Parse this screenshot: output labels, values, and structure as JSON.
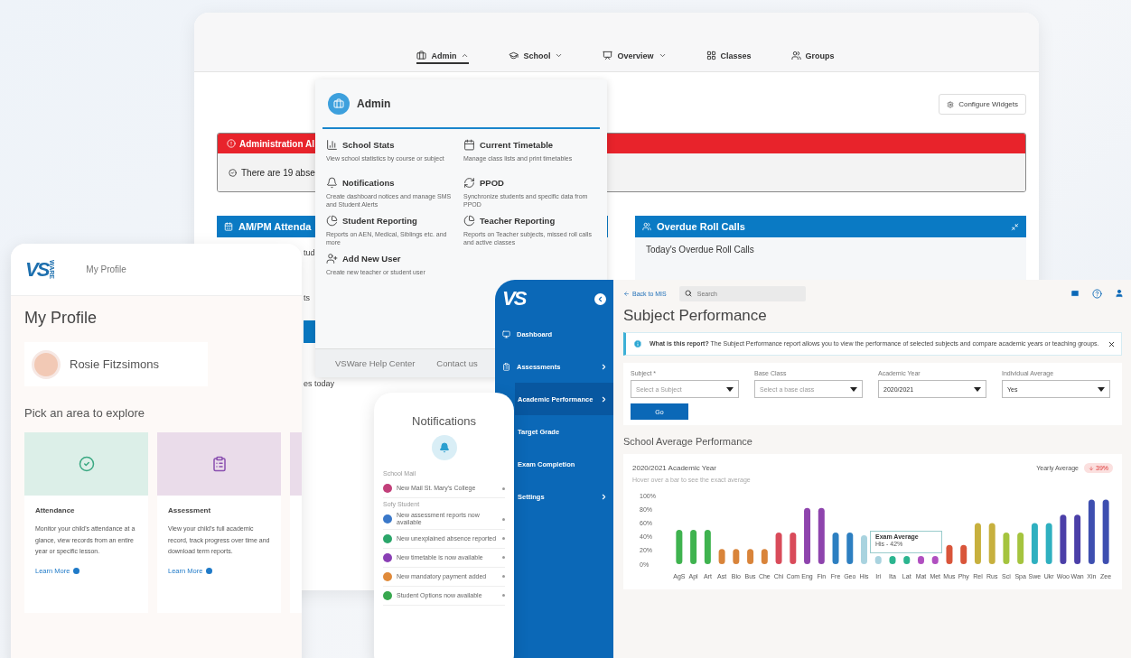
{
  "dashboard": {
    "nav": [
      {
        "label": "Admin",
        "kind": "admin",
        "selected": true,
        "expanded": true
      },
      {
        "label": "School",
        "kind": "school",
        "selected": false,
        "expanded": false
      },
      {
        "label": "Overview",
        "kind": "overview",
        "selected": false,
        "expanded": false
      },
      {
        "label": "Classes",
        "kind": "classes",
        "selected": false
      },
      {
        "label": "Groups",
        "kind": "groups",
        "selected": false
      }
    ],
    "configure_button": "Configure Widgets",
    "alert": {
      "title": "Administration Al",
      "message": "There are 19 abse"
    },
    "attendance_widget": {
      "title": "AM/PM Attenda",
      "lines": [
        "tud",
        "ts",
        "es today"
      ]
    },
    "overdue_widget": {
      "title": "Overdue Roll Calls",
      "subtitle": "Today's Overdue Roll Calls"
    }
  },
  "admin_menu": {
    "title": "Admin",
    "items": [
      {
        "kind": "stats",
        "title": "School Stats",
        "description": "View school statistics by course or subject"
      },
      {
        "kind": "timetable",
        "title": "Current Timetable",
        "description": "Manage class lists and print timetables"
      },
      {
        "kind": "notifications",
        "title": "Notifications",
        "description": "Create dashboard notices and manage SMS and Student Alerts"
      },
      {
        "kind": "sync",
        "title": "PPOD",
        "description": "Synchronize students and specific data from PPOD"
      },
      {
        "kind": "report",
        "title": "Student Reporting",
        "description": "Reports on AEN, Medical, Siblings etc. and more"
      },
      {
        "kind": "report",
        "title": "Teacher Reporting",
        "description": "Reports on Teacher subjects, missed roll calls and active classes"
      },
      {
        "kind": "user",
        "title": "Add New User",
        "description": "Create new teacher or student user"
      }
    ],
    "footer": [
      "VSWare Help Center",
      "Contact us"
    ]
  },
  "profile": {
    "logo": "VS",
    "logo_small": "WARE",
    "header": "My Profile",
    "title": "My Profile",
    "name": "Rosie Fitzsimons",
    "section": "Pick an area to explore",
    "areas": [
      {
        "kind": "attendance",
        "color": "#dcefe8",
        "title": "Attendance",
        "description": "Monitor your child's attendance at a glance, view records from an entire year or specific lesson.",
        "link": "Learn More"
      },
      {
        "kind": "assessment",
        "color": "#eadcea",
        "title": "Assessment",
        "description": "View your child's full academic record, track progress over time and download term reports.",
        "link": "Learn More"
      },
      {
        "kind": "partial",
        "color": "#eadcea"
      }
    ]
  },
  "notifications": {
    "title": "Notifications",
    "sections": [
      {
        "label": "School Mail",
        "items": [
          {
            "text": "New Mail St. Mary's College",
            "color": "#c2407a"
          }
        ]
      },
      {
        "label": "Sofy Student",
        "items": [
          {
            "text": "New assessment reports now available",
            "color": "#3a78c9"
          },
          {
            "text": "New unexplained absence reported",
            "color": "#2ba66a"
          },
          {
            "text": "New timetable is now available",
            "color": "#8a3fb5"
          },
          {
            "text": "New mandatory payment added",
            "color": "#e08a3a"
          },
          {
            "text": "Student Options now available",
            "color": "#38a84f"
          }
        ]
      }
    ]
  },
  "sidebar": {
    "logo": "VS",
    "items": [
      {
        "label": "Dashboard",
        "kind": "dashboard",
        "selected": false,
        "submenu": false
      },
      {
        "label": "Assessments",
        "kind": "assessments",
        "selected": false,
        "submenu": true
      },
      {
        "label": "Academic Performance",
        "kind": "none",
        "selected": true,
        "submenu": true
      },
      {
        "label": "Target Grade",
        "kind": "none",
        "selected": false,
        "submenu": false
      },
      {
        "label": "Exam Completion",
        "kind": "none",
        "selected": false,
        "submenu": false
      },
      {
        "label": "Settings",
        "kind": "none",
        "selected": false,
        "submenu": true
      }
    ]
  },
  "report": {
    "back_link": "Back to MIS",
    "search": {
      "placeholder": "Search"
    },
    "title": "Subject Performance",
    "info": "**What is this report?** The Subject Performance report allows you to view the performance of selected subjects and compare academic years or teaching groups.",
    "filters": [
      {
        "label": "Subject *",
        "placeholder": "Select a Subject"
      },
      {
        "label": "Base Class",
        "placeholder": "Select a base class"
      },
      {
        "label": "Academic Year",
        "value": "2020/2021"
      },
      {
        "label": "Individual Average",
        "value": "Yes"
      }
    ],
    "go_button": "Go",
    "section": "School Average Performance",
    "chart_card": {
      "title": "2020/2021 Academic Year",
      "hint": "Hover over a bar to see the exact average",
      "badge_label": "Yearly Average",
      "badge_value": "39%",
      "tooltip": {
        "text": "His - 42%"
      },
      "chart_data": {
        "type": "bar",
        "categories": [
          "AgS",
          "Apl",
          "Art",
          "Ast",
          "Bio",
          "Bus",
          "Che",
          "Chi",
          "Com",
          "Eng",
          "Fin",
          "Fre",
          "Geo",
          "His",
          "Iri",
          "Ita",
          "Lat",
          "Mat",
          "Met",
          "Mus",
          "Phy",
          "Rel",
          "Rus",
          "Sci",
          "Spa",
          "Swe",
          "Ukr",
          "Woo",
          "Wan",
          "Xin",
          "Zee"
        ],
        "series": [
          {
            "name": "Exam Average",
            "color": "#3fb34f",
            "values": [
              50,
              50,
              50,
              null,
              null,
              null,
              null,
              null,
              null,
              null,
              null,
              null,
              null,
              null,
              null,
              null,
              null,
              null,
              null,
              null,
              null,
              null,
              null,
              null,
              null,
              null,
              null,
              null,
              null,
              null,
              null
            ]
          },
          {
            "color": "#d9843a",
            "values": [
              null,
              null,
              null,
              22,
              22,
              22,
              22,
              null,
              null,
              null,
              null,
              null,
              null,
              null,
              null,
              null,
              null,
              null,
              null,
              null,
              null,
              null,
              null,
              null,
              null,
              null,
              null,
              null,
              null,
              null,
              null
            ]
          },
          {
            "color": "#d94b5a",
            "values": [
              null,
              null,
              null,
              null,
              null,
              null,
              null,
              46,
              46,
              null,
              null,
              null,
              null,
              null,
              null,
              null,
              null,
              null,
              null,
              null,
              null,
              null,
              null,
              null,
              null,
              null,
              null,
              null,
              null,
              null,
              null
            ]
          },
          {
            "color": "#8e44ad",
            "values": [
              null,
              null,
              null,
              null,
              null,
              null,
              null,
              null,
              null,
              82,
              82,
              null,
              null,
              null,
              null,
              null,
              null,
              null,
              null,
              null,
              null,
              null,
              null,
              null,
              null,
              null,
              null,
              null,
              null,
              null,
              null
            ]
          },
          {
            "color": "#2d7fc1",
            "values": [
              null,
              null,
              null,
              null,
              null,
              null,
              null,
              null,
              null,
              null,
              null,
              46,
              46,
              null,
              null,
              null,
              null,
              null,
              null,
              null,
              null,
              null,
              null,
              null,
              null,
              null,
              null,
              null,
              null,
              null,
              null
            ]
          },
          {
            "color": "#a9d3df",
            "values": [
              null,
              null,
              null,
              null,
              null,
              null,
              null,
              null,
              null,
              null,
              null,
              null,
              null,
              42,
              12,
              null,
              null,
              null,
              null,
              null,
              null,
              null,
              null,
              null,
              null,
              null,
              null,
              null,
              null,
              null,
              null
            ]
          },
          {
            "color": "#2bb58f",
            "values": [
              null,
              null,
              null,
              null,
              null,
              null,
              null,
              null,
              null,
              null,
              null,
              null,
              null,
              null,
              null,
              12,
              12,
              null,
              null,
              null,
              null,
              null,
              null,
              null,
              null,
              null,
              null,
              null,
              null,
              null,
              null
            ]
          },
          {
            "color": "#b04fc0",
            "values": [
              null,
              null,
              null,
              null,
              null,
              null,
              null,
              null,
              null,
              null,
              null,
              null,
              null,
              null,
              null,
              null,
              null,
              12,
              12,
              null,
              null,
              null,
              null,
              null,
              null,
              null,
              null,
              null,
              null,
              null,
              null
            ]
          },
          {
            "color": "#d9553a",
            "values": [
              null,
              null,
              null,
              null,
              null,
              null,
              null,
              null,
              null,
              null,
              null,
              null,
              null,
              null,
              null,
              null,
              null,
              null,
              null,
              28,
              28,
              null,
              null,
              null,
              null,
              null,
              null,
              null,
              null,
              null,
              null
            ]
          },
          {
            "color": "#c7b03e",
            "values": [
              null,
              null,
              null,
              null,
              null,
              null,
              null,
              null,
              null,
              null,
              null,
              null,
              null,
              null,
              null,
              null,
              null,
              null,
              null,
              null,
              null,
              60,
              60,
              null,
              null,
              null,
              null,
              null,
              null,
              null,
              null
            ]
          },
          {
            "color": "#a5c43e",
            "values": [
              null,
              null,
              null,
              null,
              null,
              null,
              null,
              null,
              null,
              null,
              null,
              null,
              null,
              null,
              null,
              null,
              null,
              null,
              null,
              null,
              null,
              null,
              null,
              46,
              46,
              null,
              null,
              null,
              null,
              null,
              null
            ]
          },
          {
            "color": "#2fb0c0",
            "values": [
              null,
              null,
              null,
              null,
              null,
              null,
              null,
              null,
              null,
              null,
              null,
              null,
              null,
              null,
              null,
              null,
              null,
              null,
              null,
              null,
              null,
              null,
              null,
              null,
              null,
              60,
              60,
              null,
              null,
              null,
              null
            ]
          },
          {
            "color": "#4b3fa8",
            "values": [
              null,
              null,
              null,
              null,
              null,
              null,
              null,
              null,
              null,
              null,
              null,
              null,
              null,
              null,
              null,
              null,
              null,
              null,
              null,
              null,
              null,
              null,
              null,
              null,
              null,
              null,
              null,
              72,
              72,
              null,
              null
            ]
          },
          {
            "color": "#3e4fb0",
            "values": [
              null,
              null,
              null,
              null,
              null,
              null,
              null,
              null,
              null,
              null,
              null,
              null,
              null,
              null,
              null,
              null,
              null,
              null,
              null,
              null,
              null,
              null,
              null,
              null,
              null,
              null,
              null,
              null,
              null,
              94,
              94
            ]
          }
        ],
        "ylim": [
          0,
          100
        ],
        "yticks": [
          {
            "value": 0,
            "label": "0%"
          },
          {
            "value": 20,
            "label": "20%"
          },
          {
            "value": 40,
            "label": "40%"
          },
          {
            "value": 60,
            "label": "60%"
          },
          {
            "value": 80,
            "label": "80%"
          },
          {
            "value": 100,
            "label": "100%"
          }
        ]
      }
    }
  }
}
